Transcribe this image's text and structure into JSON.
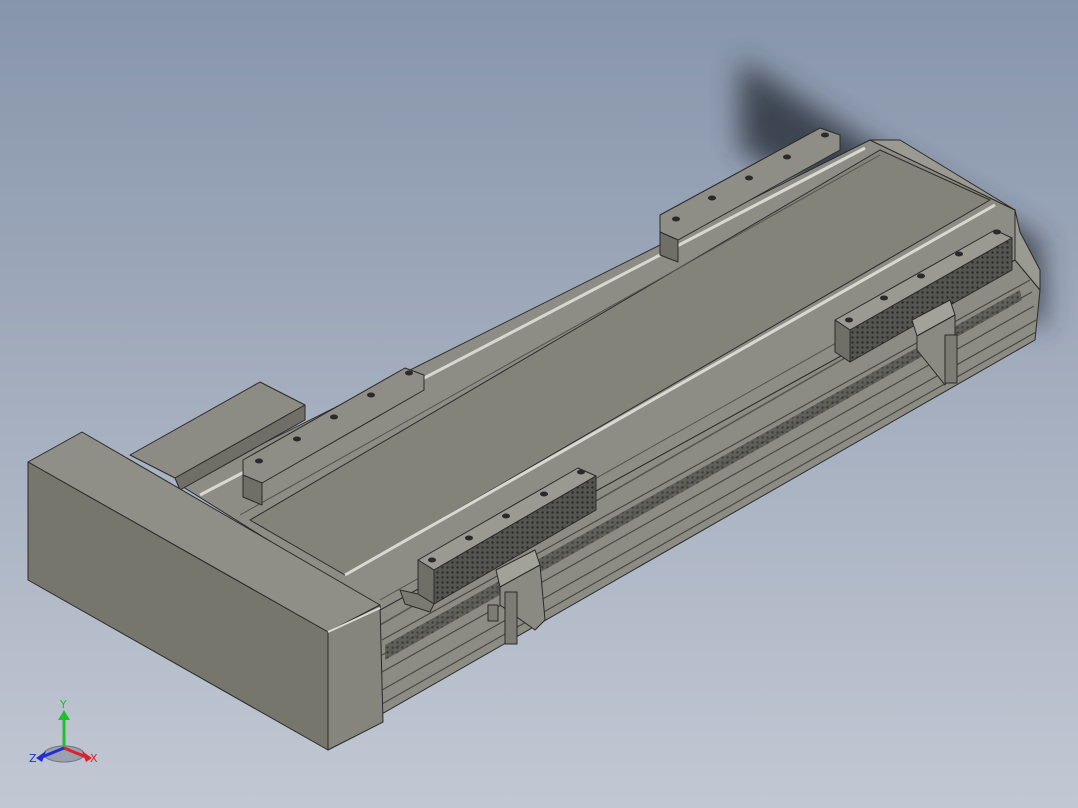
{
  "viewport": {
    "background_top": "#8795ab",
    "background_bottom": "#c2c8d3"
  },
  "model": {
    "body_light": "#8a8a80",
    "body_mid": "#7a7a70",
    "body_dark": "#5f5f58",
    "edge": "#2a2a2a",
    "rail_highlight": "#d8d8d2",
    "mesh": "#3a3a3a"
  },
  "triad": {
    "axis_y": "Y",
    "axis_x": "X",
    "axis_z": "Z",
    "color_y": "#1fbf2f",
    "color_x": "#e0202a",
    "color_z": "#2030d0"
  }
}
